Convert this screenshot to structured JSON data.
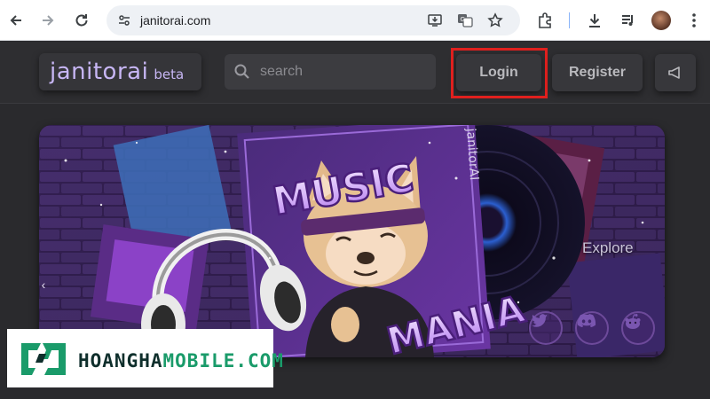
{
  "browser": {
    "url": "janitorai.com",
    "icons": [
      "back-arrow-icon",
      "forward-arrow-icon",
      "reload-icon",
      "site-info-icon",
      "install-app-icon",
      "translate-icon",
      "bookmark-star-icon",
      "extensions-icon",
      "download-icon",
      "media-control-icon",
      "avatar",
      "menu-icon"
    ]
  },
  "site": {
    "logo": {
      "name": "janitorai",
      "badge": "beta"
    },
    "search": {
      "placeholder": "search"
    },
    "auth": {
      "login": "Login",
      "register": "Register"
    },
    "colors": {
      "accent": "#c7b6f4",
      "highlight": "#e0201e",
      "background": "#2a2a2d"
    }
  },
  "banner": {
    "title_top": "MUSIC",
    "title_bottom": "MANIA",
    "album_label": "janitorAI",
    "explore": "Explore",
    "prev_arrow": "‹",
    "social_icons": [
      "twitter-icon",
      "discord-icon",
      "reddit-icon"
    ]
  },
  "watermark": {
    "text_dark": "HOANGHA",
    "text_green": "MOBILE.COM",
    "colors": {
      "dark": "#0f2f2c",
      "green": "#1a9b6a"
    }
  }
}
